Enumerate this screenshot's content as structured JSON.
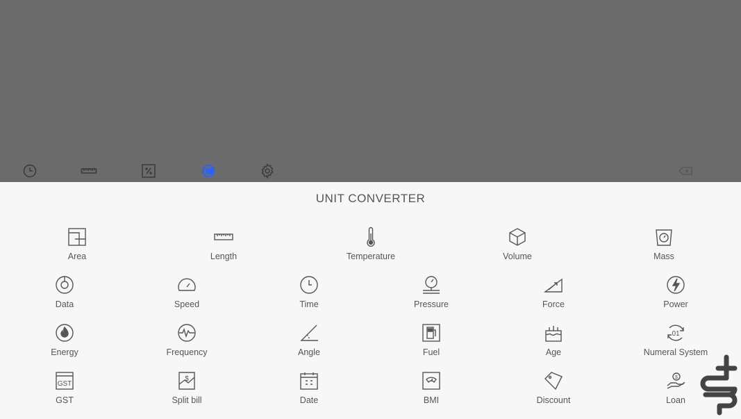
{
  "toolbar": {
    "icons": [
      "history-icon",
      "ruler-icon",
      "percent-calculator-icon",
      "unit-converter-icon",
      "settings-icon",
      "backspace-icon"
    ],
    "active_color": "#2962ff",
    "icon_color": "#3a3a3a"
  },
  "panel": {
    "title": "UNIT CONVERTER"
  },
  "converters": [
    {
      "label": "Area",
      "icon": "area-icon"
    },
    {
      "label": "Length",
      "icon": "length-icon"
    },
    {
      "label": "Temperature",
      "icon": "thermometer-icon"
    },
    {
      "label": "Volume",
      "icon": "cube-icon"
    },
    {
      "label": "Mass",
      "icon": "scale-icon"
    },
    {
      "label": "Data",
      "icon": "disc-icon"
    },
    {
      "label": "Speed",
      "icon": "speedometer-icon"
    },
    {
      "label": "Time",
      "icon": "clock-icon"
    },
    {
      "label": "Pressure",
      "icon": "pressure-gauge-icon"
    },
    {
      "label": "Force",
      "icon": "force-icon"
    },
    {
      "label": "Power",
      "icon": "lightning-icon"
    },
    {
      "label": "Energy",
      "icon": "flame-icon"
    },
    {
      "label": "Frequency",
      "icon": "pulse-icon"
    },
    {
      "label": "Angle",
      "icon": "angle-icon"
    },
    {
      "label": "Fuel",
      "icon": "fuel-pump-icon"
    },
    {
      "label": "Age",
      "icon": "cake-icon"
    },
    {
      "label": "Numeral System",
      "icon": "numeral-icon"
    },
    {
      "label": "GST",
      "icon": "gst-icon"
    },
    {
      "label": "Split bill",
      "icon": "split-bill-icon"
    },
    {
      "label": "Date",
      "icon": "calendar-icon"
    },
    {
      "label": "BMI",
      "icon": "bmi-icon"
    },
    {
      "label": "Discount",
      "icon": "tag-icon"
    },
    {
      "label": "Loan",
      "icon": "loan-icon"
    }
  ],
  "gst_icon_text": "GST",
  "numeral_icon_text": "01"
}
